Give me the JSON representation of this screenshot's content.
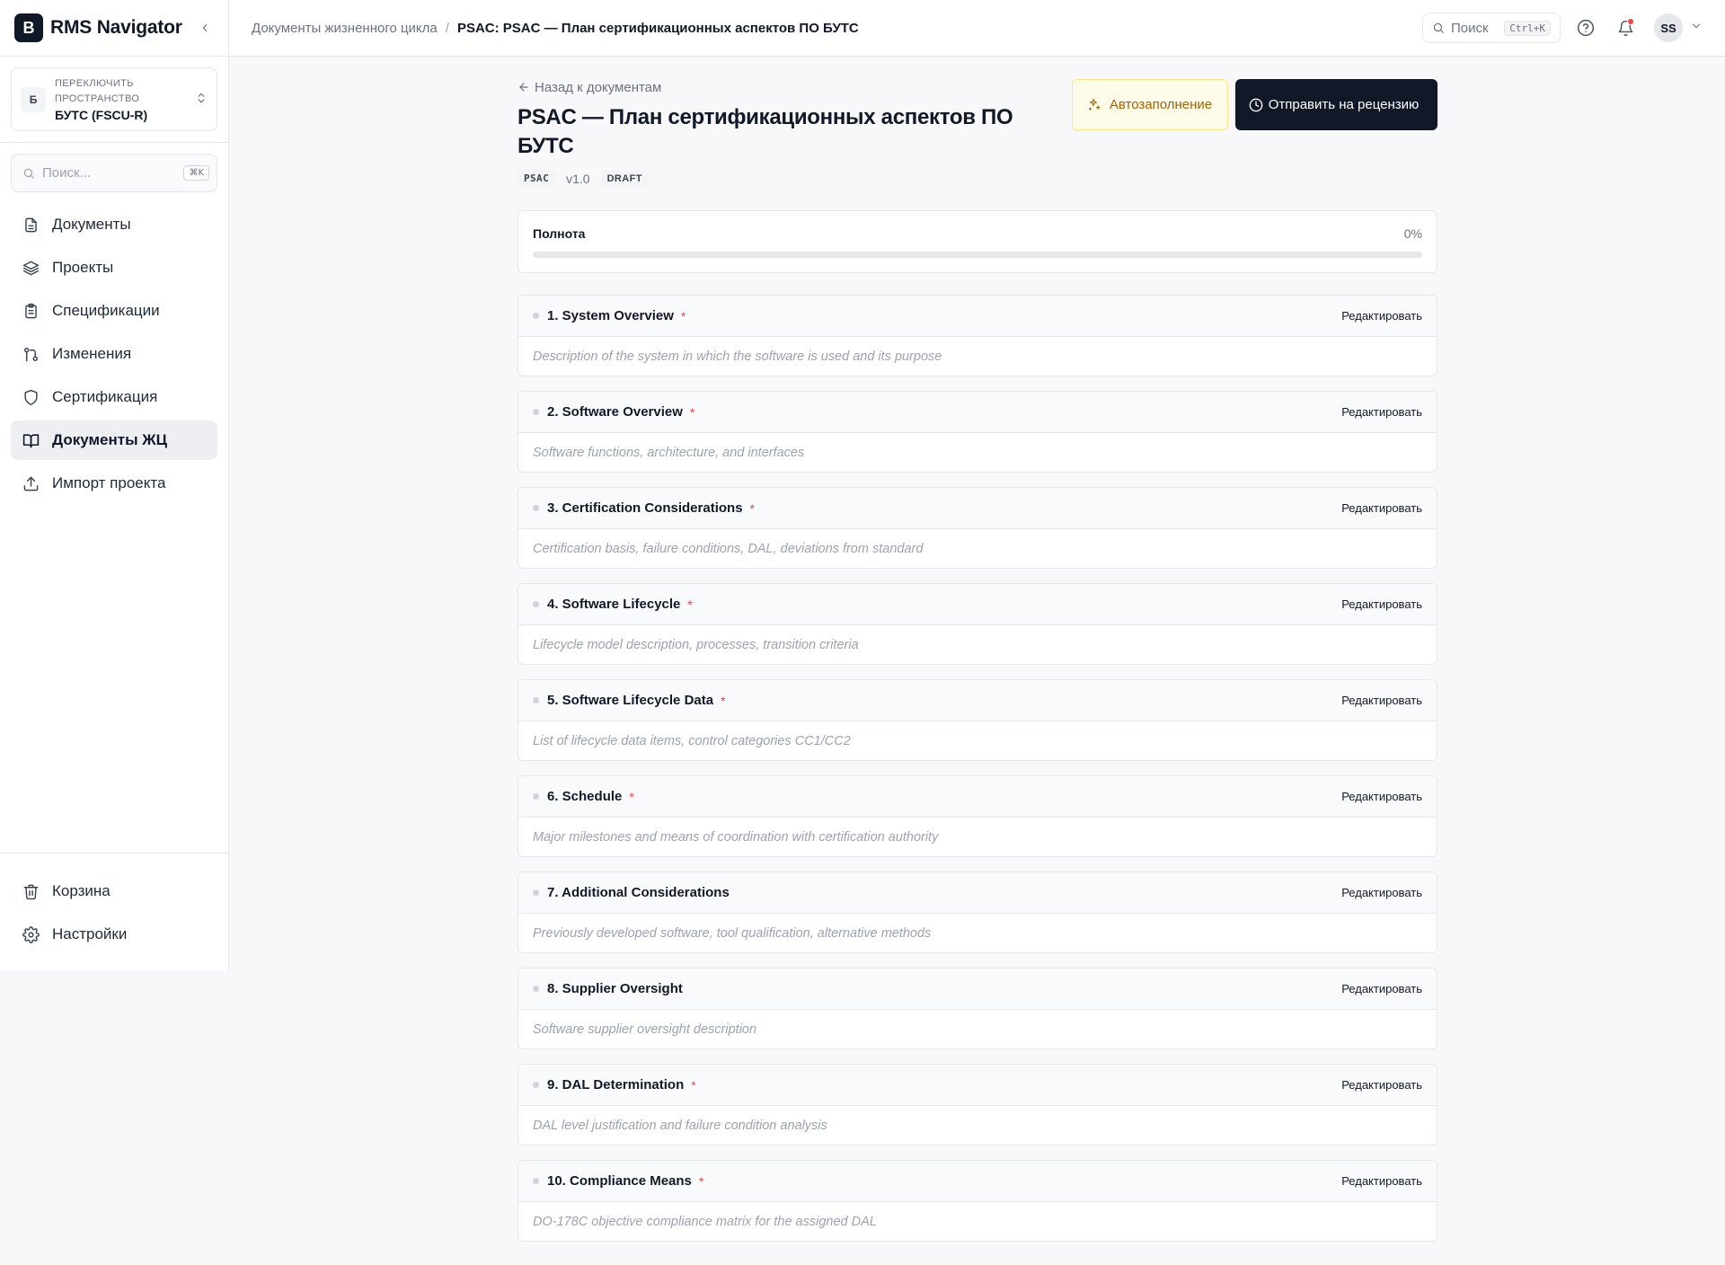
{
  "app": {
    "logo_letter": "B",
    "name": "RMS Navigator"
  },
  "workspace": {
    "avatar": "Б",
    "caption": "ПЕРЕКЛЮЧИТЬ ПРОСТРАНСТВО",
    "name": "БУТС (FSCU-R)"
  },
  "sidebar_search": {
    "placeholder": "Поиск...",
    "shortcut": "⌘K"
  },
  "nav": {
    "items": [
      {
        "label": "Документы",
        "icon": "file-text-icon"
      },
      {
        "label": "Проекты",
        "icon": "layers-icon"
      },
      {
        "label": "Спецификации",
        "icon": "clipboard-list-icon"
      },
      {
        "label": "Изменения",
        "icon": "git-pull-request-icon"
      },
      {
        "label": "Сертификация",
        "icon": "shield-icon"
      },
      {
        "label": "Документы ЖЦ",
        "icon": "book-open-icon",
        "active": true
      },
      {
        "label": "Импорт проекта",
        "icon": "upload-icon"
      }
    ],
    "bottom": [
      {
        "label": "Корзина",
        "icon": "trash-icon"
      },
      {
        "label": "Настройки",
        "icon": "settings-icon"
      }
    ]
  },
  "breadcrumb": {
    "parent": "Документы жизненного цикла",
    "separator": "/",
    "current": "PSAC: PSAC — План сертификационных аспектов ПО БУТС"
  },
  "topbar": {
    "search_label": "Поиск",
    "search_shortcut": "Ctrl+K",
    "user_initials": "SS"
  },
  "document": {
    "back_label": "Назад к документам",
    "title": "PSAC — План сертификационных аспектов ПО БУТС",
    "type_tag": "PSAC",
    "version": "v1.0",
    "status": "DRAFT",
    "autofill_label": "Автозаполнение",
    "submit_label": "Отправить на рецензию"
  },
  "completeness": {
    "label": "Полнота",
    "value_text": "0%",
    "fraction": 0
  },
  "sections": [
    {
      "title": "1. System Overview",
      "required": true,
      "edit": "Редактировать",
      "description": "Description of the system in which the software is used and its purpose"
    },
    {
      "title": "2. Software Overview",
      "required": true,
      "edit": "Редактировать",
      "description": "Software functions, architecture, and interfaces"
    },
    {
      "title": "3. Certification Considerations",
      "required": true,
      "edit": "Редактировать",
      "description": "Certification basis, failure conditions, DAL, deviations from standard"
    },
    {
      "title": "4. Software Lifecycle",
      "required": true,
      "edit": "Редактировать",
      "description": "Lifecycle model description, processes, transition criteria"
    },
    {
      "title": "5. Software Lifecycle Data",
      "required": true,
      "edit": "Редактировать",
      "description": "List of lifecycle data items, control categories CC1/CC2"
    },
    {
      "title": "6. Schedule",
      "required": true,
      "edit": "Редактировать",
      "description": "Major milestones and means of coordination with certification authority"
    },
    {
      "title": "7. Additional Considerations",
      "required": false,
      "edit": "Редактировать",
      "description": "Previously developed software, tool qualification, alternative methods"
    },
    {
      "title": "8. Supplier Oversight",
      "required": false,
      "edit": "Редактировать",
      "description": "Software supplier oversight description"
    },
    {
      "title": "9. DAL Determination",
      "required": true,
      "edit": "Редактировать",
      "description": "DAL level justification and failure condition analysis"
    },
    {
      "title": "10. Compliance Means",
      "required": true,
      "edit": "Редактировать",
      "description": "DO-178C objective compliance matrix for the assigned DAL"
    }
  ],
  "required_marker": "*"
}
